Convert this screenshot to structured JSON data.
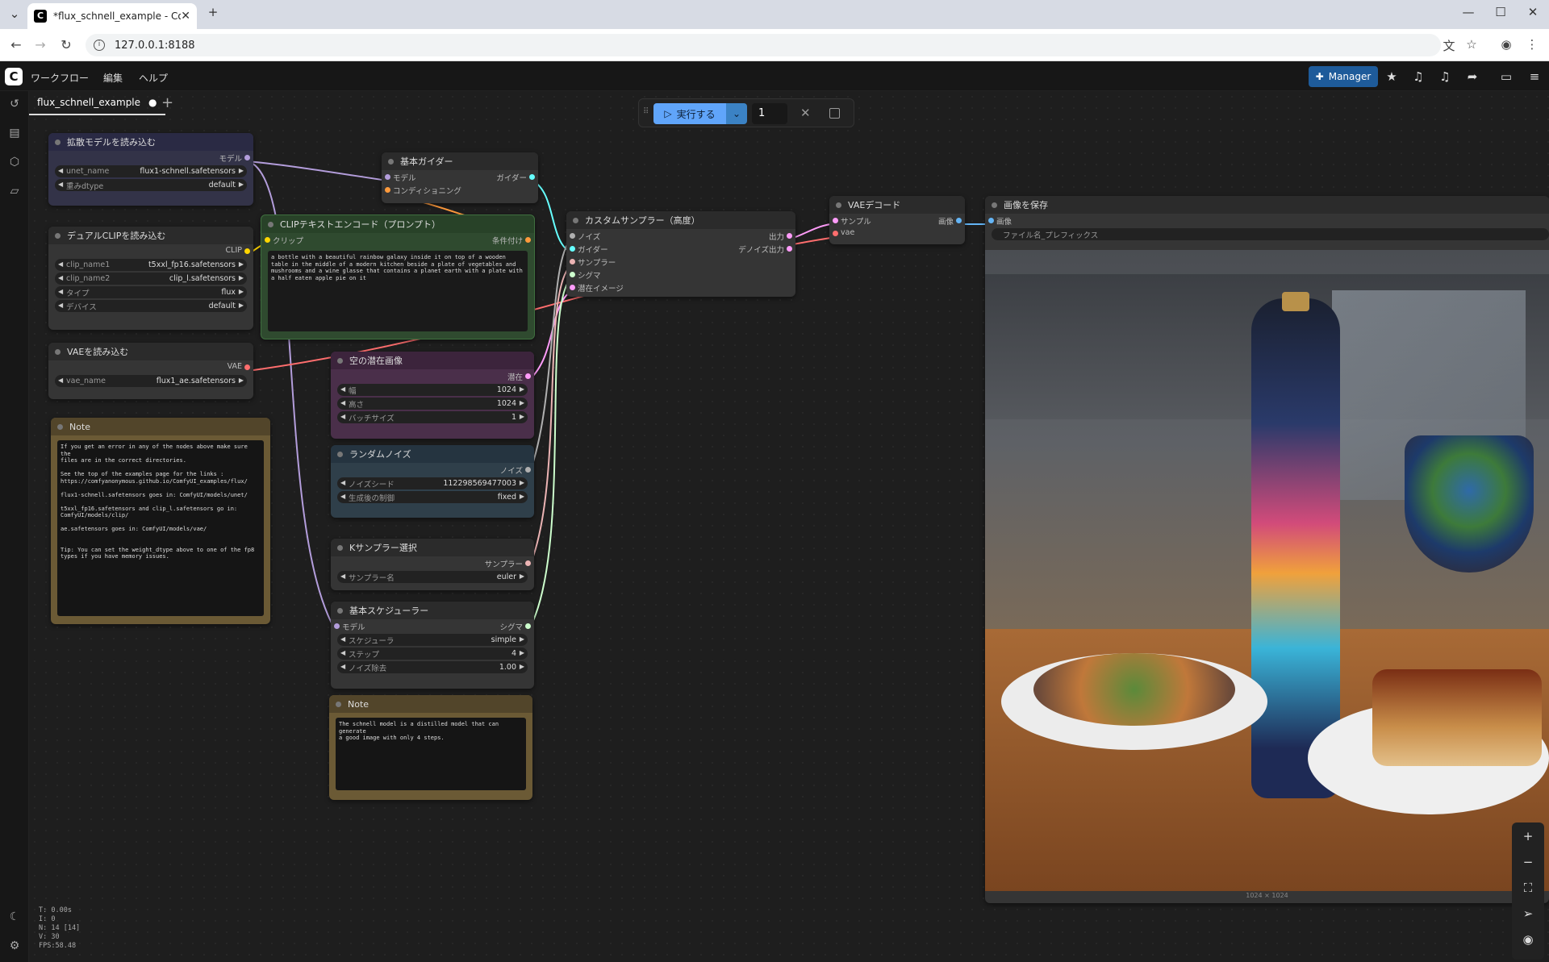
{
  "browser": {
    "tab_title": "*flux_schnell_example - ComfyU",
    "url": "127.0.0.1:8188"
  },
  "menubar": {
    "items": [
      "ワークフロー",
      "編集",
      "ヘルプ"
    ],
    "manager_label": "Manager"
  },
  "workflow_tab": {
    "label": "flux_schnell_example",
    "modified_dot": "●"
  },
  "run_bar": {
    "run_label": "実行する",
    "count": "1"
  },
  "nodes": {
    "load_diffusion": {
      "title": "拡散モデルを読み込む",
      "out": "モデル",
      "w1_label": "unet_name",
      "w1_value": "flux1-schnell.safetensors",
      "w2_label": "重みdtype",
      "w2_value": "default"
    },
    "dual_clip": {
      "title": "デュアルCLIPを読み込む",
      "out": "CLIP",
      "w1_label": "clip_name1",
      "w1_value": "t5xxl_fp16.safetensors",
      "w2_label": "clip_name2",
      "w2_value": "clip_l.safetensors",
      "w3_label": "タイプ",
      "w3_value": "flux",
      "w4_label": "デバイス",
      "w4_value": "default"
    },
    "load_vae": {
      "title": "VAEを読み込む",
      "out": "VAE",
      "w1_label": "vae_name",
      "w1_value": "flux1_ae.safetensors"
    },
    "note1": {
      "title": "Note",
      "text": "If you get an error in any of the nodes above make sure the\nfiles are in the correct directories.\n\nSee the top of the examples page for the links :\nhttps://comfyanonymous.github.io/ComfyUI_examples/flux/\n\nflux1-schnell.safetensors goes in: ComfyUI/models/unet/\n\nt5xxl_fp16.safetensors and clip_l.safetensors go in:\nComfyUI/models/clip/\n\nae.safetensors goes in: ComfyUI/models/vae/\n\n\nTip: You can set the weight_dtype above to one of the fp8\ntypes if you have memory issues."
    },
    "basic_guider": {
      "title": "基本ガイダー",
      "in1": "モデル",
      "in2": "コンディショニング",
      "out": "ガイダー"
    },
    "clip_encode": {
      "title": "CLIPテキストエンコード（プロンプト）",
      "in1": "クリップ",
      "out": "条件付け",
      "text": "a bottle with a beautiful rainbow galaxy inside it on top of a wooden table in the middle of a modern kitchen beside a plate of vegetables and mushrooms and a wine glasse that contains a planet earth with a plate with a half eaten apple pie on it"
    },
    "empty_latent": {
      "title": "空の潜在画像",
      "out": "潜在",
      "w1_label": "幅",
      "w1_value": "1024",
      "w2_label": "高さ",
      "w2_value": "1024",
      "w3_label": "バッチサイズ",
      "w3_value": "1"
    },
    "random_noise": {
      "title": "ランダムノイズ",
      "out": "ノイズ",
      "w1_label": "ノイズシード",
      "w1_value": "112298569477003",
      "w2_label": "生成後の制御",
      "w2_value": "fixed"
    },
    "ksampler_select": {
      "title": "Kサンプラー選択",
      "out": "サンプラー",
      "w1_label": "サンプラー名",
      "w1_value": "euler"
    },
    "basic_scheduler": {
      "title": "基本スケジューラー",
      "in1": "モデル",
      "out": "シグマ",
      "w1_label": "スケジューラ",
      "w1_value": "simple",
      "w2_label": "ステップ",
      "w2_value": "4",
      "w3_label": "ノイズ除去",
      "w3_value": "1.00"
    },
    "note2": {
      "title": "Note",
      "text": "The schnell model is a distilled model that can generate\na good image with only 4 steps."
    },
    "custom_sampler": {
      "title": "カスタムサンプラー（高度）",
      "in1": "ノイズ",
      "in2": "ガイダー",
      "in3": "サンプラー",
      "in4": "シグマ",
      "in5": "潜在イメージ",
      "out1": "出力",
      "out2": "デノイズ出力"
    },
    "vae_decode": {
      "title": "VAEデコード",
      "in1": "サンプル",
      "in2": "vae",
      "out": "画像"
    },
    "save_image": {
      "title": "画像を保存",
      "in1": "画像",
      "w1_value": "ファイル名_プレフィックス",
      "size_label": "1024 × 1024"
    }
  },
  "stats": {
    "t": "T: 0.00s",
    "i": "I: 0",
    "n": "N: 14 [14]",
    "v": "V: 30",
    "fps": "FPS:58.48"
  },
  "colors": {
    "model": "#b39ddb",
    "clip": "#ffd500",
    "vae": "#ff6e6e",
    "latent": "#ff9cf9",
    "noise": "#b0b0b0",
    "guider": "#66ffff",
    "sigmas": "#cdffcd",
    "sampler": "#ecb4b4",
    "image": "#64b5f6"
  }
}
